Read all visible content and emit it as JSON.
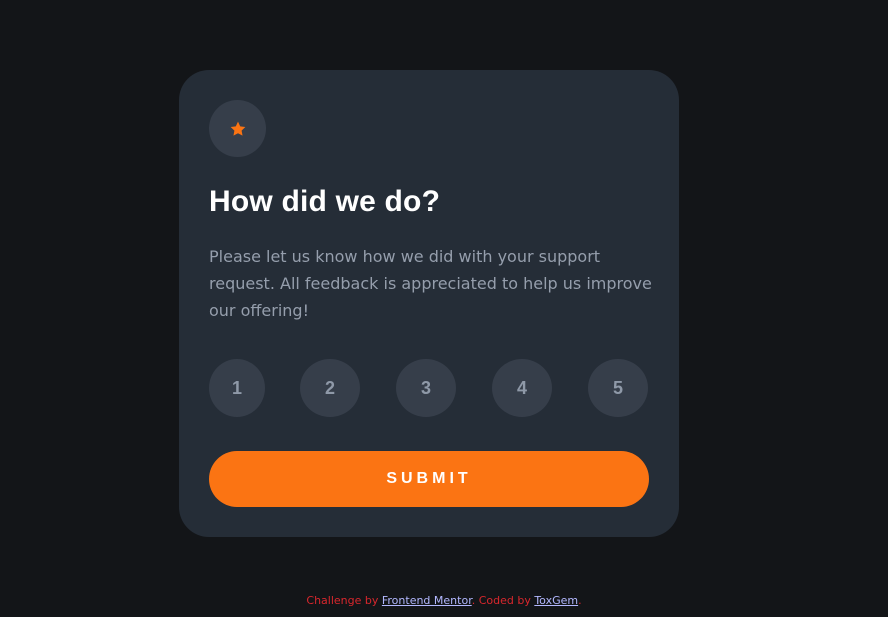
{
  "card": {
    "icon": "star-icon",
    "title": "How did we do?",
    "description": "Please let us know how we did with your support request. All feedback is appreciated to help us improve our offering!",
    "ratings": [
      "1",
      "2",
      "3",
      "4",
      "5"
    ],
    "submit_label": "SUBMIT"
  },
  "attribution": {
    "prefix": "Challenge by ",
    "link1": "Frontend Mentor",
    "middle": ". Coded by ",
    "link2": "ToxGem",
    "suffix": "."
  },
  "colors": {
    "background": "#131518",
    "card": "#252d37",
    "circle": "#363e4a",
    "accent": "#fb7413",
    "text_muted": "#959eac",
    "attribution": "#d9272d",
    "link": "#b3b8ff"
  }
}
